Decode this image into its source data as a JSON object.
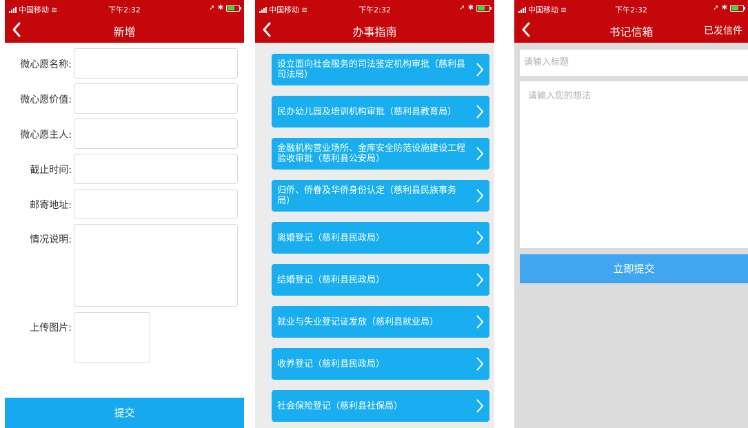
{
  "status": {
    "carrier": "中国移动",
    "time": "下午2:32"
  },
  "screen_add": {
    "title": "新增",
    "fields": [
      {
        "label": "微心愿名称:"
      },
      {
        "label": "微心愿价值:"
      },
      {
        "label": "微心愿主人:"
      },
      {
        "label": "截止时间:"
      },
      {
        "label": "邮寄地址:"
      },
      {
        "label": "情况说明:"
      }
    ],
    "upload_label": "上传图片:",
    "submit_label": "提交"
  },
  "screen_guide": {
    "title": "办事指南",
    "items": [
      "设立面向社会服务的司法鉴定机构审批（慈利县司法局）",
      "民办幼儿园及培训机构审批（慈利县教育局）",
      "金融机构营业场所、金库安全防范设施建设工程验收审批（慈利县公安局）",
      "归侨、侨眷及华侨身份认定（慈利县民族事务局）",
      "离婚登记（慈利县民政局）",
      "结婚登记（慈利县民政局）",
      "就业与失业登记证发放（慈利县就业局）",
      "收养登记（慈利县民政局）",
      "社会保险登记（慈利县社保局）"
    ]
  },
  "screen_mailbox": {
    "title": "书记信箱",
    "action_label": "已发信件",
    "title_placeholder": "请输入标题",
    "content_placeholder": "请输入您的想法",
    "submit_label": "立即提交"
  },
  "colors": {
    "nav_red": "#c5060b",
    "button_blue": "#16a9ef",
    "item_blue": "#18aef0",
    "submit_blue": "#40a6f0"
  }
}
